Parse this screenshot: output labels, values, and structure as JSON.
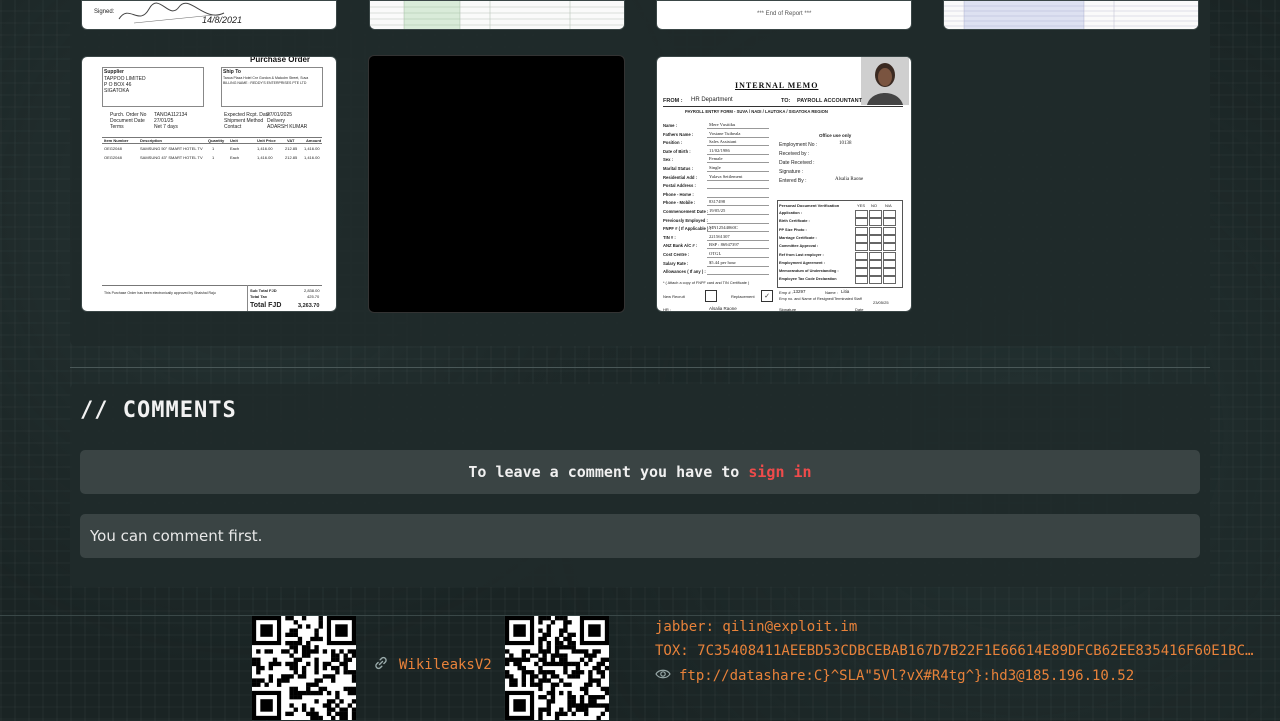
{
  "gallery": {
    "top_row_text": {
      "signed_label": "Signed:",
      "signed_date": "14/8/2021",
      "end_of_report": "*** End of Report ***"
    },
    "purchase_order": {
      "title": "Purchase Order",
      "supplier_label": "Supplier",
      "supplier_name": "TAPPOO LIMITED",
      "supplier_box": "P O BOX 46",
      "supplier_city": "SIGATOKA",
      "ship_to_label": "Ship To",
      "ship_to_addr": "Tanoa Plaza Hotel Cnr Gordon & Malcolm Street, Suva",
      "billing": "BILLING NAME : REDDY'S ENTERPRISES PTE LTD",
      "order_no_label": "Purch. Order No",
      "order_no": "TANOA112134",
      "doc_date_label": "Document Date",
      "doc_date": "27/01/25",
      "terms_label": "Terms",
      "terms": "Net 7 days",
      "exp_date_label": "Expected Rcpt. Date",
      "exp_date": "27/01/2025",
      "ship_method_label": "Shipment Method",
      "ship_method": "Delivery",
      "contact_label": "Contact",
      "contact": "ADARSH KUMAR",
      "headers": [
        "Item Number",
        "Description",
        "Quantity",
        "Unit",
        "Unit Price",
        "VAT",
        "Amount"
      ],
      "rows": [
        [
          "OEG2048",
          "SAMSUNG 50\" SMART HOTEL TV",
          "1",
          "Each",
          "1,416.00",
          "212.85",
          "1,416.00"
        ],
        [
          "OEG2048",
          "SAMSUNG 43\" SMART HOTEL TV",
          "1",
          "Each",
          "1,416.00",
          "212.85",
          "1,416.00"
        ]
      ],
      "footer_note": "This Purchase Order has been electronically approved by Shaishal Raju",
      "sub_total_label": "Sub Total FJD",
      "sub_total": "2,838.00",
      "total_tax_label": "Total Tax",
      "total_tax": "425.70",
      "total_label": "Total FJD",
      "total": "3,263.70"
    },
    "memo": {
      "title": "INTERNAL MEMO",
      "from_label": "FROM :",
      "from": "HR Department",
      "to_label": "TO:",
      "to": "PAYROLL ACCOUNTANT",
      "form_title": "PAYROLL ENTRY FORM - SUVA / NADI / LAUTOKA / SIGATOKA REGION",
      "fields": [
        {
          "label": "Name :",
          "value": "Mere Vusitiku"
        },
        {
          "label": "Fathers Name :",
          "value": "Vosiane Tuibeala"
        },
        {
          "label": "Position :",
          "value": "Sales Assistant"
        },
        {
          "label": "Date of Birth :",
          "value": "11/02/1986"
        },
        {
          "label": "Sex :",
          "value": "Female"
        },
        {
          "label": "Marital Status :",
          "value": "Single"
        },
        {
          "label": "Residential Add :",
          "value": "Yalava Settlement"
        },
        {
          "label": "Postal Address :",
          "value": ""
        },
        {
          "label": "Phone - Home :",
          "value": ""
        },
        {
          "label": "Phone - Mobile :",
          "value": "8317498"
        },
        {
          "label": "Commencement Date :",
          "value": "19/05/25"
        },
        {
          "label": "Previously Employed :",
          "value": ""
        },
        {
          "label": "FNPF # ( If Applicable ) :",
          "value": "MN12544060C"
        },
        {
          "label": "TIN # :",
          "value": "221561307"
        },
        {
          "label": "ANZ Bank A/C # :",
          "value": "BSP : 86947397"
        },
        {
          "label": "Cost Centre :",
          "value": "OTGL"
        },
        {
          "label": "Salary Rate :",
          "value": "$5.44 per hour"
        },
        {
          "label": "Allowances ( If any ) :",
          "value": ""
        }
      ],
      "office_use": "Office use only",
      "emp_no_label": "Employment No :",
      "emp_no": "10138",
      "received_by": "Received by :",
      "date_received": "Date Received :",
      "signature_label": "Signature :",
      "entered_by_label": "Entered By :",
      "entered_by": "Alsalia Raone",
      "verification_title": "Personal Document Verification",
      "yes": "YES",
      "no": "NO",
      "na": "N/A",
      "checks": [
        "Application :",
        "Birth Certificate :",
        "PP Size Photo :",
        "Marriage Certificate :",
        "Committee Approval :",
        "Ref from Last employer :",
        "Employment Agreement :",
        "Memorandum of Understanding :",
        "Employee Tax Code Declaration"
      ],
      "fnpf_copy": "* ( Attach a copy of FNPF card and TIN Certificate )",
      "new_recruit": "New Recruit",
      "replacement": "Replacement",
      "emp_label": "Emp # :",
      "emp_value": "13297",
      "name2_label": "Name :",
      "name2": "Litia",
      "drop_note": "Emp no. and Name of Resigned/Terminated Staff",
      "hr_label": "HR :",
      "hr_name": "Alsalia Raone",
      "sig_label": "Signature",
      "date_label": "Date",
      "date_value": "23/05/25"
    }
  },
  "comments": {
    "title": "// COMMENTS",
    "signin_prefix": "To leave a comment you have to ",
    "signin_link": "sign in",
    "empty_message": "You can comment first."
  },
  "footer": {
    "mirror_link": "WikileaksV2",
    "jabber": "jabber: qilin@exploit.im",
    "tox": "TOX: 7C35408411AEEBD53CDBCEBAB167D7B22F1E66614E89DFCB62EE835416F60E1BC…",
    "ftp": "ftp://datashare:C}^SLA\"5Vl?vX#R4tg^}:hd3@185.196.10.52"
  },
  "colors": {
    "accent": "#e8823a",
    "link_red": "#ef4b4b",
    "panel": "#202a2a"
  },
  "icons": {
    "link": "link-icon",
    "eye": "eye-icon"
  }
}
